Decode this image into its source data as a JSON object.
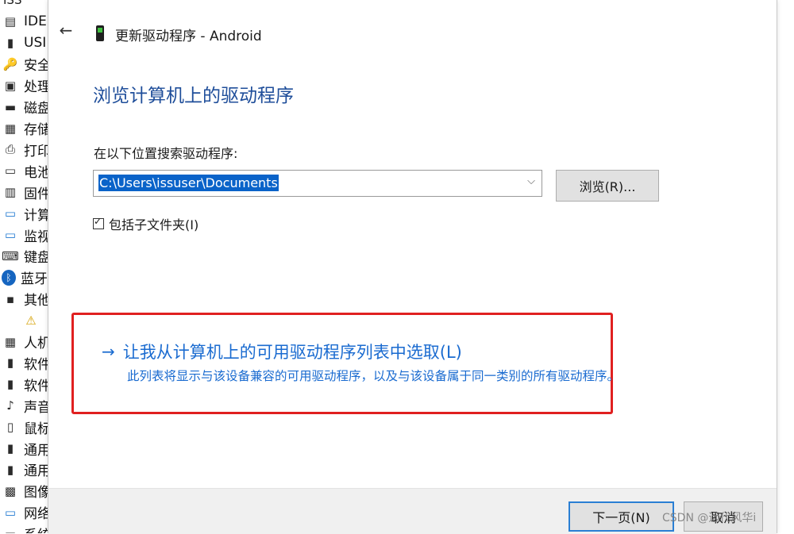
{
  "background": {
    "top_text": "ISS",
    "tree_items": [
      {
        "label": "IDE",
        "icon": "ide-controller-icon"
      },
      {
        "label": "USI",
        "icon": "usb-icon"
      },
      {
        "label": "安全",
        "icon": "security-key-icon"
      },
      {
        "label": "处理",
        "icon": "processor-icon"
      },
      {
        "label": "磁盘",
        "icon": "disk-drive-icon"
      },
      {
        "label": "存储",
        "icon": "storage-controller-icon"
      },
      {
        "label": "打印",
        "icon": "printer-icon"
      },
      {
        "label": "电池",
        "icon": "battery-icon"
      },
      {
        "label": "固件",
        "icon": "firmware-icon"
      },
      {
        "label": "计算",
        "icon": "computer-icon"
      },
      {
        "label": "监视",
        "icon": "monitor-icon"
      },
      {
        "label": "键盘",
        "icon": "keyboard-icon"
      },
      {
        "label": "蓝牙",
        "icon": "bluetooth-icon"
      },
      {
        "label": "其他",
        "icon": "other-devices-icon"
      },
      {
        "label": "",
        "icon": "warning-device-icon",
        "indent": true
      },
      {
        "label": "人机",
        "icon": "hid-icon"
      },
      {
        "label": "软件",
        "icon": "software-device-icon"
      },
      {
        "label": "软件",
        "icon": "software-component-icon"
      },
      {
        "label": "声音",
        "icon": "sound-icon"
      },
      {
        "label": "鼠标",
        "icon": "mouse-icon"
      },
      {
        "label": "通用",
        "icon": "usb-controller-icon"
      },
      {
        "label": "通用",
        "icon": "usb-device-icon"
      },
      {
        "label": "图像",
        "icon": "imaging-device-icon"
      },
      {
        "label": "网络",
        "icon": "network-adapter-icon"
      },
      {
        "label": "系统",
        "icon": "system-device-icon"
      }
    ]
  },
  "dialog": {
    "title": "更新驱动程序 - Android",
    "heading": "浏览计算机上的驱动程序",
    "search_label": "在以下位置搜索驱动程序:",
    "path_value": "C:\\Users\\issuser\\Documents",
    "browse_label": "浏览(R)...",
    "include_subfolders_label": "包括子文件夹(I)",
    "include_subfolders_checked": true,
    "pick_link_text": "让我从计算机上的可用驱动程序列表中选取(L)",
    "pick_link_desc": "此列表将显示与该设备兼容的可用驱动程序，以及与该设备属于同一类别的所有驱动程序。",
    "next_label": "下一页(N)",
    "cancel_label": "取消"
  },
  "watermark": "CSDN @远代风华i",
  "colors": {
    "accent": "#0a63c9",
    "link": "#1a6bd0",
    "highlight_border": "#e02020"
  }
}
